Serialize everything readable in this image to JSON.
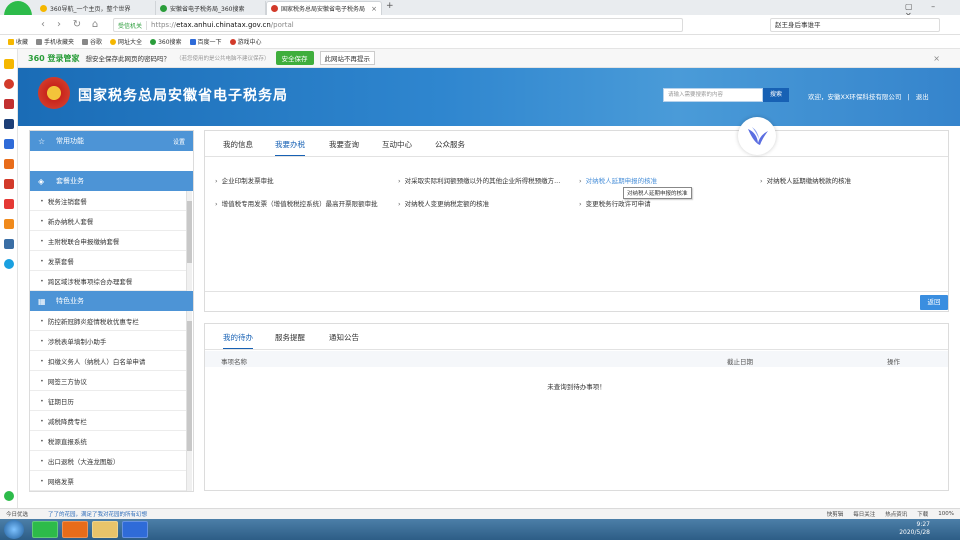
{
  "browser": {
    "tabs": [
      {
        "label": "360导航_一个主页，整个世界",
        "color": "#f5b700"
      },
      {
        "label": "安徽省电子税务局_360搜索",
        "color": "#2a9d3a"
      },
      {
        "label": "国家税务总局安徽省电子税务局",
        "color": "#d23a2a",
        "close": "×"
      }
    ],
    "new_tab": "+",
    "secure_label": "受信机关",
    "url_prefix": "https://",
    "url_host": "etax.anhui.chinatax.gov.cn",
    "url_path": "/portal",
    "search_text": "赵王身后事谁平",
    "bookmarks": [
      {
        "label": "收藏",
        "color": "#f5b700"
      },
      {
        "label": "手机收藏夹",
        "color": "#888888"
      },
      {
        "label": "谷歌",
        "color": "#888888"
      },
      {
        "label": "网址大全",
        "color": "#f5b700"
      },
      {
        "label": "360搜索",
        "color": "#2a9d3a"
      },
      {
        "label": "百度一下",
        "color": "#2f6bd8"
      },
      {
        "label": "游戏中心",
        "color": "#d23a2a"
      }
    ]
  },
  "password_bar": {
    "logo": "360 登录管家",
    "question": "想安全保存此网页的密码吗？",
    "hint": "（若您使用的是公共电脑不建议保存）",
    "save": "安全保存",
    "nosave": "此网站不再提示",
    "close": "×"
  },
  "site": {
    "title": "国家税务总局安徽省电子税务局",
    "search_placeholder": "请输入需要搜索的内容",
    "search_button": "搜索",
    "welcome": "欢迎，安徽XX环保科技有限公司",
    "logout": "退出"
  },
  "left_panel": {
    "common": {
      "title": "常用功能",
      "more": "设置"
    },
    "package": {
      "title": "套餐业务",
      "items": [
        "税务注销套餐",
        "新办纳税人套餐",
        "主附税联合申报缴纳套餐",
        "发票套餐",
        "跨区域涉税事项综合办理套餐"
      ]
    },
    "special": {
      "title": "特色业务",
      "items": [
        "防控新冠肺炎疫情税收优惠专栏",
        "涉税表单填制小助手",
        "扣缴义务人（纳税人）白名单申请",
        "网签三方协议",
        "征期日历",
        "减税降费专栏",
        "税源直报系统",
        "出口退税（大连龙图版）",
        "网络发票"
      ]
    }
  },
  "main_tabs": [
    {
      "label": "我的信息",
      "active": false
    },
    {
      "label": "我要办税",
      "active": true
    },
    {
      "label": "我要查询",
      "active": false
    },
    {
      "label": "互动中心",
      "active": false
    },
    {
      "label": "公众服务",
      "active": false
    }
  ],
  "services": [
    {
      "label": "企业印制发票审批"
    },
    {
      "label": "对采取实际利润额预缴以外的其他企业所得税预缴方..."
    },
    {
      "label": "对纳税人延期申报的核准",
      "highlight": true
    },
    {
      "label": "对纳税人延期缴纳税款的核准"
    },
    {
      "label": "增值税专用发票（增值税税控系统）最高开票限额审批"
    },
    {
      "label": "对纳税人变更纳税定额的核准"
    },
    {
      "label": "变更税务行政许可申请"
    }
  ],
  "tooltip": "对纳税人延期申报的核准",
  "back_button": "返回",
  "todo": {
    "tabs": [
      {
        "label": "我的待办",
        "active": true
      },
      {
        "label": "服务提醒",
        "active": false
      },
      {
        "label": "通知公告",
        "active": false
      }
    ],
    "columns": [
      "事项名称",
      "截止日期",
      "操作"
    ],
    "empty": "未查询到待办事项！"
  },
  "statusbar": {
    "left": "今日优选",
    "news": "了了的花园，满足了我对花园的所有幻想",
    "items": [
      "快剪辑",
      "每日关注",
      "热点资讯",
      "下载",
      "100%"
    ]
  },
  "clock": {
    "time": "9:27",
    "date": "2020/5/28"
  }
}
